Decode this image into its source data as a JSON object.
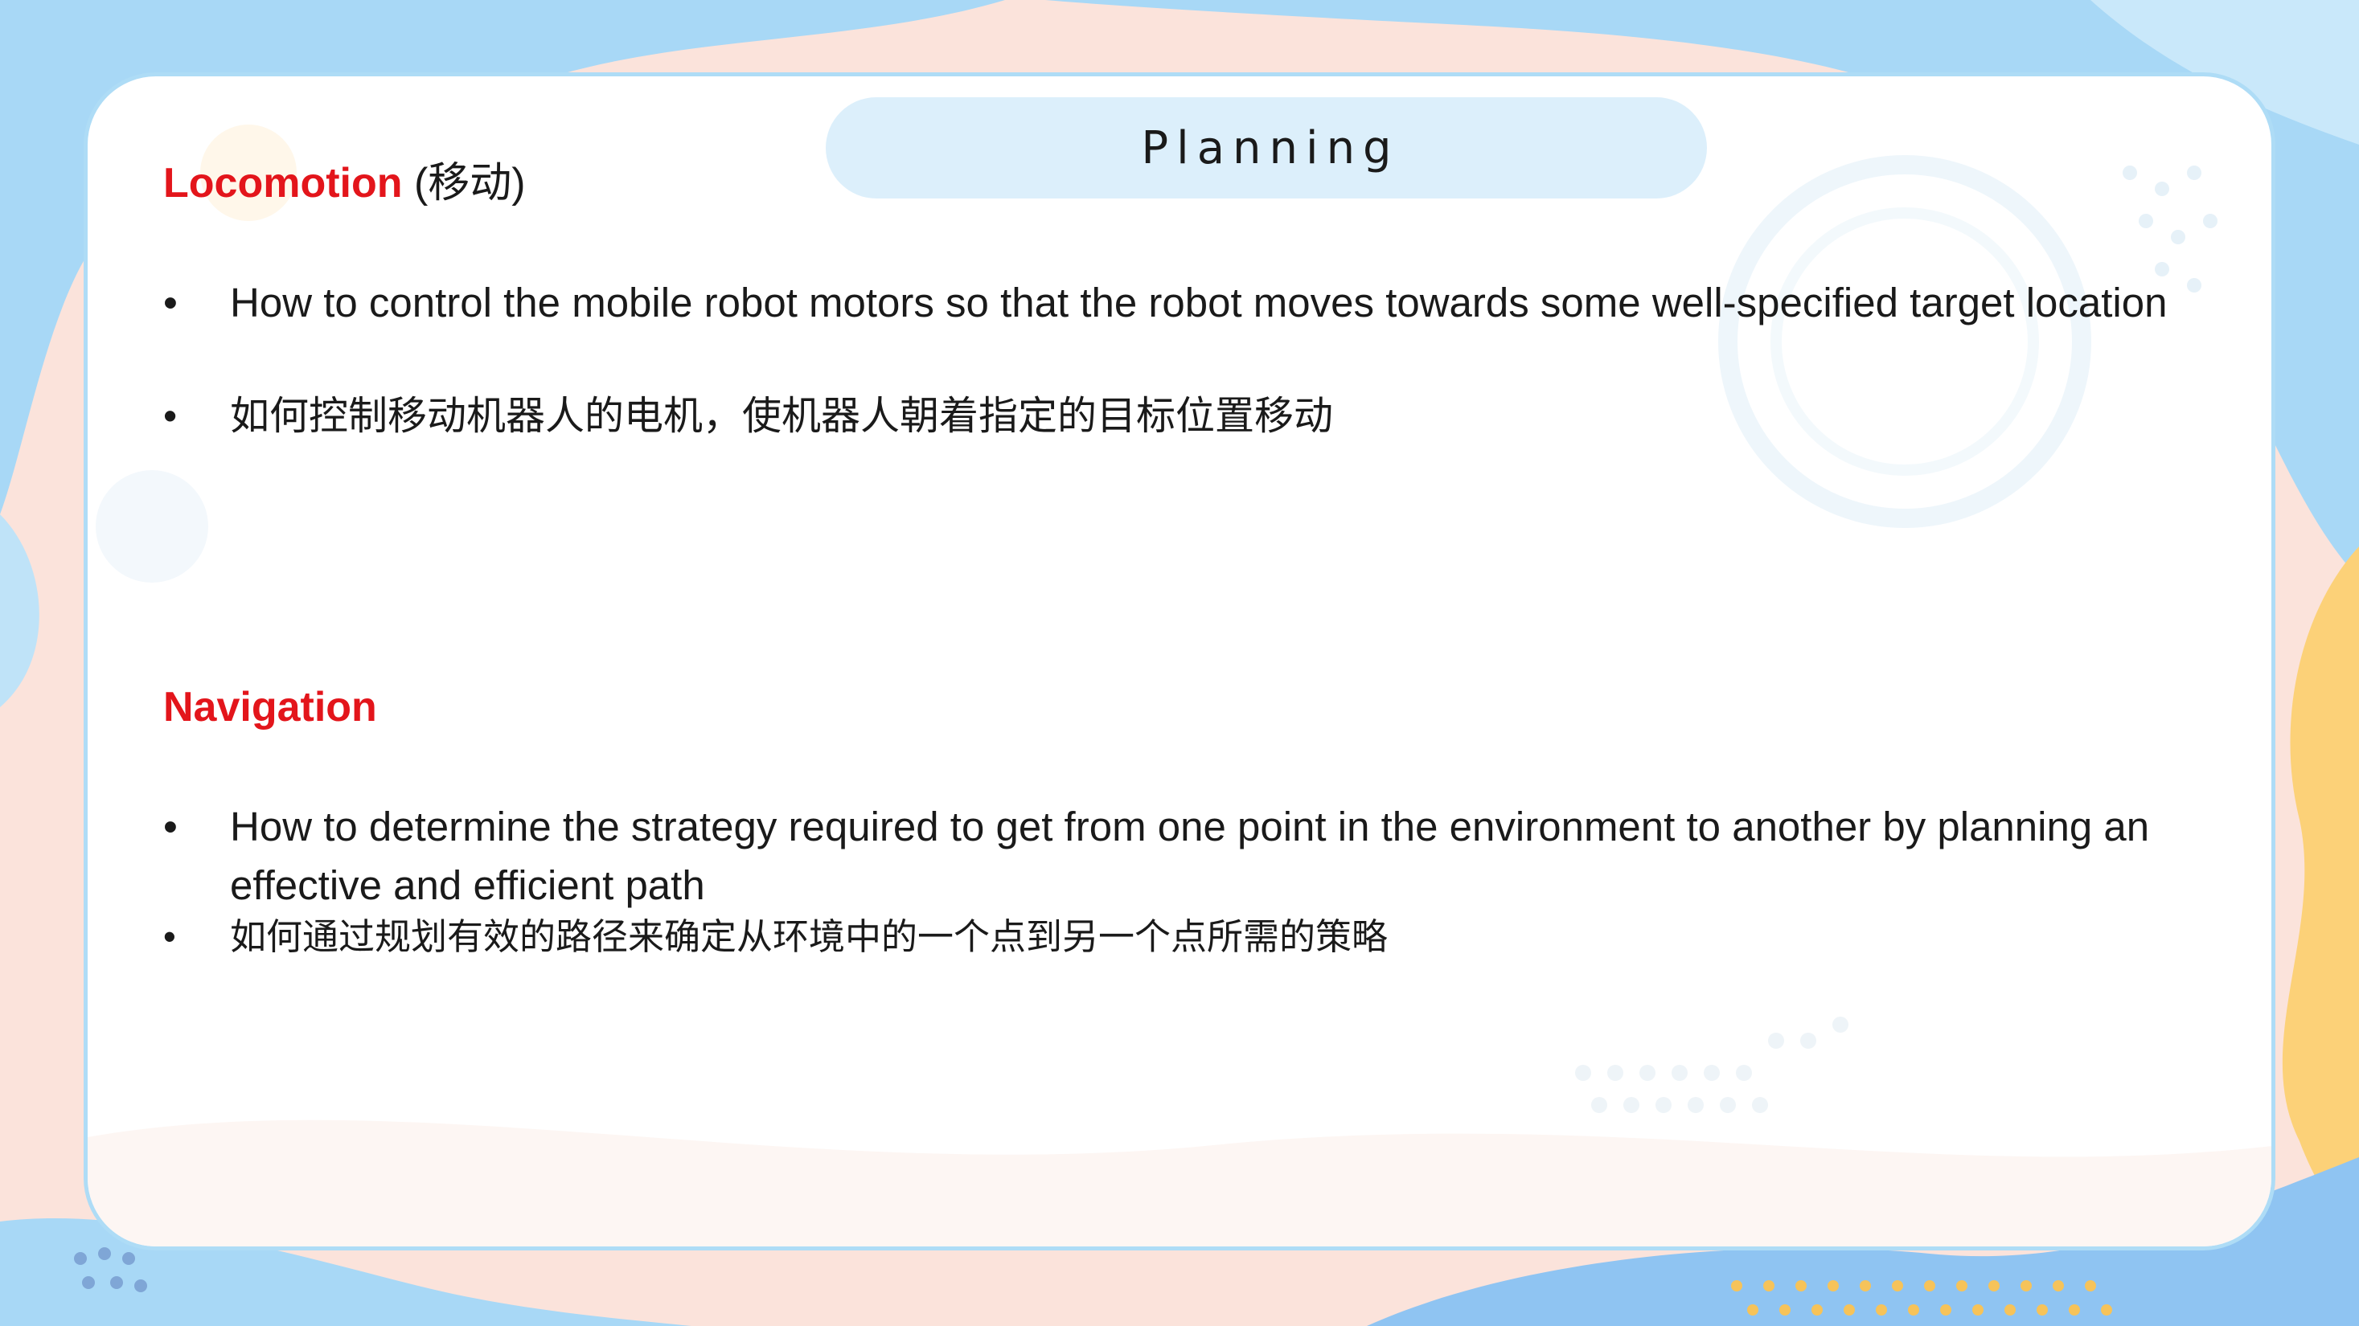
{
  "slide": {
    "title": "Planning",
    "sections": [
      {
        "keyword": "Locomotion",
        "note": " (移动)",
        "bullets": [
          "How to control the mobile robot motors so that the robot moves towards some well-specified target location",
          "如何控制移动机器人的电机，使机器人朝着指定的目标位置移动"
        ]
      },
      {
        "keyword": "Navigation",
        "note": "",
        "bullets": [
          "How to determine the strategy required to get from one point in the environment to another by planning an effective and efficient path",
          "如何通过规划有效的路径来确定从环境中的一个点到另一个点所需的策略"
        ]
      }
    ],
    "bullet_glyph": "•"
  },
  "colors": {
    "keyword": "#e3151b",
    "body_text": "#1a1a1a",
    "card_border": "#aedcf6",
    "title_pill": "#d6ecfa",
    "bg_blue": "#9fd4f6",
    "bg_pink": "#fbe3db",
    "bg_yellow": "#fcd178"
  }
}
